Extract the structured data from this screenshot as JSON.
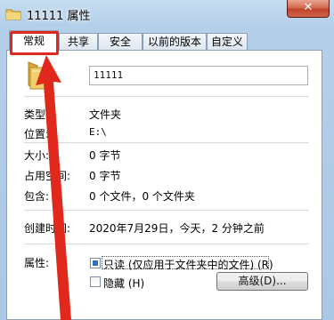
{
  "window": {
    "title": "11111 属性",
    "close_label": "✕"
  },
  "tabs": [
    {
      "label": "常规",
      "active": true
    },
    {
      "label": "共享",
      "active": false
    },
    {
      "label": "安全",
      "active": false
    },
    {
      "label": "以前的版本",
      "active": false
    },
    {
      "label": "自定义",
      "active": false
    }
  ],
  "general": {
    "folder_name": "11111",
    "type_label": "类型:",
    "type_value": "文件夹",
    "location_label": "位置:",
    "location_value": "E:\\",
    "size_label": "大小:",
    "size_value": "0 字节",
    "disk_size_label": "占用空间:",
    "disk_size_value": "0 字节",
    "contains_label": "包含:",
    "contains_value": "0 个文件，0 个文件夹",
    "created_label": "创建时间:",
    "created_value": "2020年7月29日，今天，2 分钟之前",
    "attributes_label": "属性:",
    "readonly_label": "只读 (仅应用于文件夹中的文件) (R)",
    "hidden_label": "隐藏 (H)",
    "advanced_label": "高级(D)..."
  },
  "annotation": {
    "color": "#e0281c"
  }
}
